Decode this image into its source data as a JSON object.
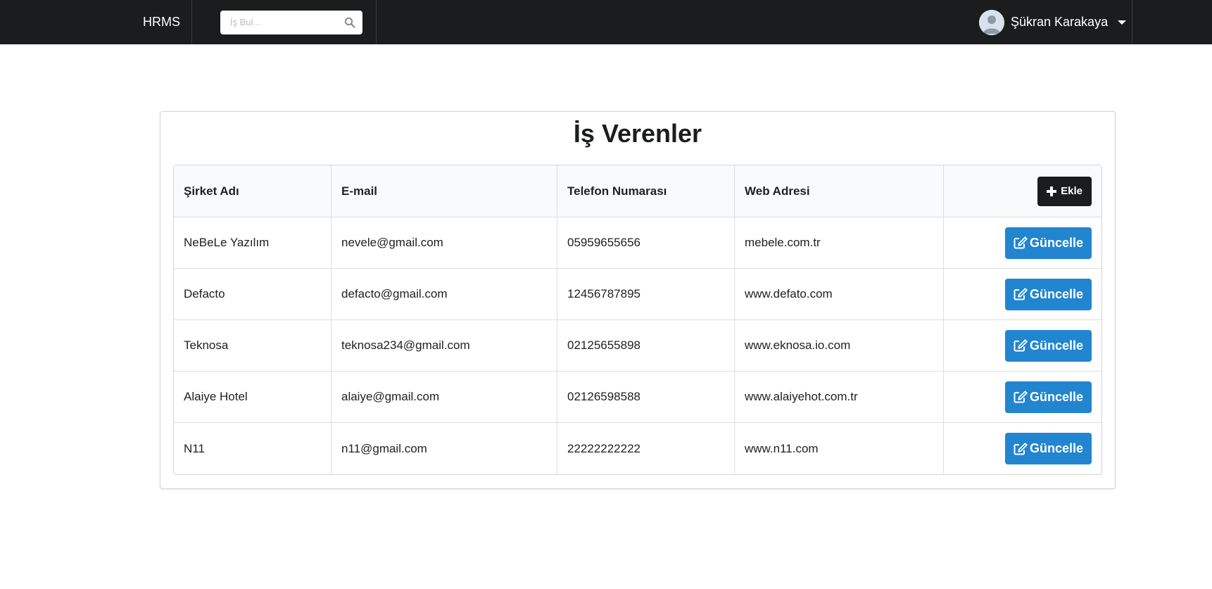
{
  "nav": {
    "brand": "HRMS",
    "search_placeholder": "İş Bul...",
    "search_icon": "search-icon",
    "user_name": "Şükran Karakaya",
    "user_avatar_icon": "user-avatar-icon",
    "dropdown_icon": "caret-down-icon"
  },
  "page": {
    "title": "İş Verenler"
  },
  "table": {
    "headers": {
      "company": "Şirket Adı",
      "email": "E-mail",
      "phone": "Telefon Numarası",
      "web": "Web Adresi"
    },
    "add_button": "Ekle",
    "update_button": "Güncelle",
    "rows": [
      {
        "company": "NeBeLe Yazılım",
        "email": "nevele@gmail.com",
        "phone": "05959655656",
        "web": "mebele.com.tr"
      },
      {
        "company": "Defacto",
        "email": "defacto@gmail.com",
        "phone": "12456787895",
        "web": "www.defato.com"
      },
      {
        "company": "Teknosa",
        "email": "teknosa234@gmail.com",
        "phone": "02125655898",
        "web": "www.eknosa.io.com"
      },
      {
        "company": "Alaiye Hotel",
        "email": "alaiye@gmail.com",
        "phone": "02126598588",
        "web": "www.alaiyehot.com.tr"
      },
      {
        "company": "N11",
        "email": "n11@gmail.com",
        "phone": "22222222222",
        "web": "www.n11.com"
      }
    ]
  },
  "colors": {
    "navbar": "#1b1c1d",
    "primary_button": "#2185d0",
    "add_button": "#1b1c1d"
  }
}
